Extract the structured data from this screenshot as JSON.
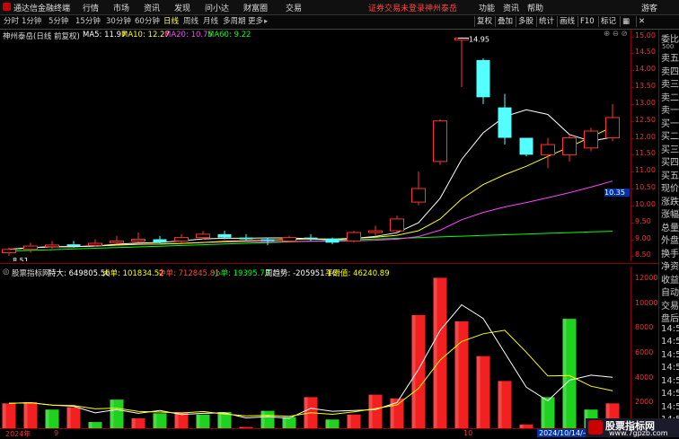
{
  "menubar": {
    "app_title": "通达信金融终端",
    "items": [
      "行情",
      "市场",
      "资讯",
      "发现",
      "问小达",
      "财富圈",
      "交易"
    ],
    "notice": "证券交易未登录",
    "stock_name": "神州泰岳",
    "right_items": [
      "功能",
      "资讯",
      "帮助"
    ],
    "guest": "游客"
  },
  "toolbar": {
    "periods": [
      "分时",
      "1分钟",
      "5分钟",
      "15分钟",
      "30分钟",
      "60分钟",
      "日线",
      "周线",
      "月线",
      "多周期",
      "更多"
    ],
    "active_period": "日线",
    "right_buttons": [
      "复权",
      "叠加",
      "多股",
      "统计",
      "画线",
      "F10",
      "标记"
    ]
  },
  "main_info": {
    "title": "神州泰岳(日线 前复权)",
    "ma": [
      {
        "label": "MA5: 11.97",
        "color": "#ffffff"
      },
      {
        "label": "MA10: 12.27",
        "color": "#ffff00"
      },
      {
        "label": "MA20: 10.75",
        "color": "#ff44ff"
      },
      {
        "label": "MA60: 9.22",
        "color": "#00ff00"
      }
    ]
  },
  "price_axis": {
    "ticks": [
      "15.00",
      "14.50",
      "14.00",
      "13.50",
      "13.00",
      "12.50",
      "12.00",
      "11.50",
      "11.00",
      "10.50",
      "10.00",
      "9.50",
      "9.00",
      "8.50"
    ],
    "current": "10.35",
    "high_label": "14.95",
    "low_label": "8.51"
  },
  "vol_info": {
    "title": "股票指标网",
    "items": [
      {
        "label": "特大: 649805.56",
        "color": "#ffffff"
      },
      {
        "label": "大单: 101834.52",
        "color": "#ffff00"
      },
      {
        "label": "中单: 712845.81",
        "color": "#ff4444"
      },
      {
        "label": "小单: 19395.73",
        "color": "#00ff00"
      },
      {
        "label": "周趋势: -205951.16",
        "color": "#ffffff"
      },
      {
        "label": "平滑值: 46240.89",
        "color": "#ffff00"
      }
    ]
  },
  "vol_axis": {
    "ticks": [
      "12000",
      "10000",
      "8000",
      "6000",
      "4000",
      "2000"
    ]
  },
  "date_axis": {
    "labels": [
      "2024年",
      "9",
      "10"
    ],
    "cursor_date": "2024/10/14/—"
  },
  "side_panel": {
    "top_label": "委比",
    "small_value": "500",
    "labels": [
      "卖五",
      "卖四",
      "卖三",
      "卖二",
      "卖一",
      "买一",
      "买二",
      "买三",
      "买四",
      "买五",
      "现价",
      "涨跌",
      "涨幅",
      "总量",
      "外盘",
      "换手",
      "净资",
      "收益",
      "自动",
      "交易",
      "盘后",
      "14:5",
      "14:5",
      "14:5",
      "14:5",
      "14:5",
      "14:5",
      "14:5",
      "14:5",
      "14:5"
    ]
  },
  "watermark": {
    "title": "股票指标网",
    "url": "www.7gpzb.com"
  },
  "chart_data": {
    "type": "candlestick",
    "candles": [
      {
        "o": 8.6,
        "c": 8.7,
        "h": 8.75,
        "l": 8.51
      },
      {
        "o": 8.7,
        "c": 8.8,
        "h": 8.9,
        "l": 8.6
      },
      {
        "o": 8.78,
        "c": 8.83,
        "h": 8.95,
        "l": 8.72
      },
      {
        "o": 8.85,
        "c": 8.8,
        "h": 8.95,
        "l": 8.75
      },
      {
        "o": 8.82,
        "c": 8.88,
        "h": 9.0,
        "l": 8.78
      },
      {
        "o": 8.9,
        "c": 8.95,
        "h": 9.1,
        "l": 8.85
      },
      {
        "o": 8.95,
        "c": 9.0,
        "h": 9.2,
        "l": 8.9
      },
      {
        "o": 9.0,
        "c": 8.9,
        "h": 9.1,
        "l": 8.88
      },
      {
        "o": 8.95,
        "c": 9.05,
        "h": 9.15,
        "l": 8.9
      },
      {
        "o": 9.05,
        "c": 9.15,
        "h": 9.25,
        "l": 9.0
      },
      {
        "o": 9.15,
        "c": 9.05,
        "h": 9.25,
        "l": 9.0
      },
      {
        "o": 9.05,
        "c": 9.0,
        "h": 9.15,
        "l": 8.95
      },
      {
        "o": 9.0,
        "c": 8.95,
        "h": 9.05,
        "l": 8.82
      },
      {
        "o": 8.95,
        "c": 9.05,
        "h": 9.1,
        "l": 8.9
      },
      {
        "o": 9.05,
        "c": 9.02,
        "h": 9.15,
        "l": 8.95
      },
      {
        "o": 9.02,
        "c": 8.9,
        "h": 9.05,
        "l": 8.85
      },
      {
        "o": 8.95,
        "c": 9.2,
        "h": 9.25,
        "l": 8.9
      },
      {
        "o": 9.2,
        "c": 9.25,
        "h": 9.4,
        "l": 9.1
      },
      {
        "o": 9.25,
        "c": 9.6,
        "h": 9.7,
        "l": 9.2
      },
      {
        "o": 10.1,
        "c": 10.5,
        "h": 11.0,
        "l": 10.0
      },
      {
        "o": 11.3,
        "c": 12.5,
        "h": 12.55,
        "l": 11.2
      },
      {
        "o": 14.9,
        "c": 14.95,
        "h": 14.95,
        "l": 13.5
      },
      {
        "o": 14.3,
        "c": 13.2,
        "h": 14.35,
        "l": 13.0
      },
      {
        "o": 12.9,
        "c": 12.0,
        "h": 13.3,
        "l": 11.8
      },
      {
        "o": 12.0,
        "c": 11.5,
        "h": 12.0,
        "l": 11.45
      },
      {
        "o": 11.5,
        "c": 11.8,
        "h": 12.0,
        "l": 11.1
      },
      {
        "o": 11.5,
        "c": 12.0,
        "h": 12.1,
        "l": 11.3
      },
      {
        "o": 11.7,
        "c": 12.2,
        "h": 12.3,
        "l": 11.6
      },
      {
        "o": 12.0,
        "c": 12.6,
        "h": 13.0,
        "l": 11.9
      }
    ],
    "volume": [
      {
        "v": 2000,
        "up": true
      },
      {
        "v": 2100,
        "up": true
      },
      {
        "v": 1500,
        "up": false
      },
      {
        "v": 1700,
        "up": true
      },
      {
        "v": 500,
        "up": false
      },
      {
        "v": 2300,
        "up": false
      },
      {
        "v": 800,
        "up": true
      },
      {
        "v": 1200,
        "up": false
      },
      {
        "v": 1300,
        "up": true
      },
      {
        "v": 1100,
        "up": false
      },
      {
        "v": 1300,
        "up": false
      },
      {
        "v": 100,
        "up": true
      },
      {
        "v": 1400,
        "up": false
      },
      {
        "v": 900,
        "up": false
      },
      {
        "v": 2500,
        "up": true
      },
      {
        "v": 700,
        "up": false
      },
      {
        "v": 1100,
        "up": true
      },
      {
        "v": 2700,
        "up": true
      },
      {
        "v": 2400,
        "up": true
      },
      {
        "v": 9100,
        "up": true
      },
      {
        "v": 12100,
        "up": true
      },
      {
        "v": 8600,
        "up": true
      },
      {
        "v": 5800,
        "up": true
      },
      {
        "v": 3800,
        "up": true
      },
      {
        "v": 300,
        "up": true
      },
      {
        "v": 2500,
        "up": false
      },
      {
        "v": 8800,
        "up": false
      },
      {
        "v": 1500,
        "up": false
      },
      {
        "v": 2000,
        "up": true
      }
    ]
  }
}
